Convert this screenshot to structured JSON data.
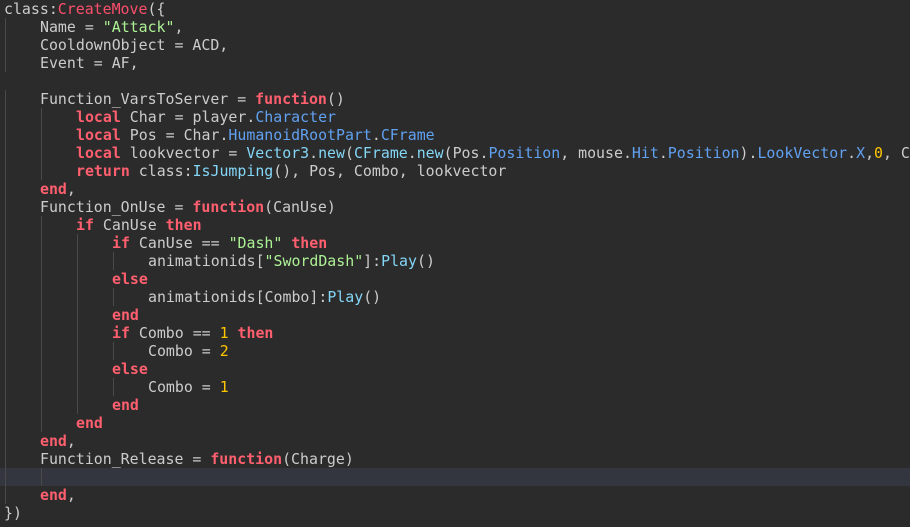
{
  "theme": {
    "background": "#2b2b2b",
    "current_line": "#34363f",
    "text": "#cccccc",
    "keyword": "#ff5f6e",
    "function_name": "#fd4e6b",
    "string": "#adf195",
    "number": "#ffc600",
    "property": "#61a1f1",
    "builtin": "#84d6f7"
  },
  "current_line_index": 26,
  "lines": [
    {
      "indent": 0,
      "tokens": [
        [
          "t",
          "class:"
        ],
        [
          "fn",
          "CreateMove"
        ],
        [
          "t",
          "({"
        ]
      ]
    },
    {
      "indent": 1,
      "tokens": [
        [
          "t",
          "Name = "
        ],
        [
          "str",
          "\"Attack\""
        ],
        [
          "t",
          ","
        ]
      ]
    },
    {
      "indent": 1,
      "tokens": [
        [
          "t",
          "CooldownObject = ACD,"
        ]
      ]
    },
    {
      "indent": 1,
      "tokens": [
        [
          "t",
          "Event = AF,"
        ]
      ]
    },
    {
      "indent": 0,
      "tokens": []
    },
    {
      "indent": 1,
      "tokens": [
        [
          "t",
          "Function_VarsToServer = "
        ],
        [
          "kw",
          "function"
        ],
        [
          "t",
          "()"
        ]
      ]
    },
    {
      "indent": 2,
      "tokens": [
        [
          "kw",
          "local"
        ],
        [
          "t",
          " Char = player."
        ],
        [
          "prop",
          "Character"
        ]
      ]
    },
    {
      "indent": 2,
      "tokens": [
        [
          "kw",
          "local"
        ],
        [
          "t",
          " Pos = Char."
        ],
        [
          "prop",
          "HumanoidRootPart"
        ],
        [
          "t",
          "."
        ],
        [
          "prop",
          "CFrame"
        ]
      ]
    },
    {
      "indent": 2,
      "tokens": [
        [
          "kw",
          "local"
        ],
        [
          "t",
          " lookvector = "
        ],
        [
          "builtin",
          "Vector3"
        ],
        [
          "t",
          "."
        ],
        [
          "builtin",
          "new"
        ],
        [
          "t",
          "("
        ],
        [
          "builtin",
          "CFrame"
        ],
        [
          "t",
          "."
        ],
        [
          "builtin",
          "new"
        ],
        [
          "t",
          "(Pos."
        ],
        [
          "prop",
          "Position"
        ],
        [
          "t",
          ", mouse."
        ],
        [
          "prop",
          "Hit"
        ],
        [
          "t",
          "."
        ],
        [
          "prop",
          "Position"
        ],
        [
          "t",
          ")."
        ],
        [
          "prop",
          "LookVector"
        ],
        [
          "t",
          "."
        ],
        [
          "prop",
          "X"
        ],
        [
          "t",
          ","
        ],
        [
          "num",
          "0"
        ],
        [
          "t",
          ", C"
        ]
      ]
    },
    {
      "indent": 2,
      "tokens": [
        [
          "kw",
          "return"
        ],
        [
          "t",
          " class:"
        ],
        [
          "builtin",
          "IsJumping"
        ],
        [
          "t",
          "(), Pos, Combo, lookvector"
        ]
      ]
    },
    {
      "indent": 1,
      "tokens": [
        [
          "kw",
          "end"
        ],
        [
          "t",
          ","
        ]
      ]
    },
    {
      "indent": 1,
      "tokens": [
        [
          "t",
          "Function_OnUse = "
        ],
        [
          "kw",
          "function"
        ],
        [
          "t",
          "(CanUse)"
        ]
      ]
    },
    {
      "indent": 2,
      "tokens": [
        [
          "kw",
          "if"
        ],
        [
          "t",
          " CanUse "
        ],
        [
          "kw",
          "then"
        ]
      ]
    },
    {
      "indent": 3,
      "tokens": [
        [
          "kw",
          "if"
        ],
        [
          "t",
          " CanUse == "
        ],
        [
          "str",
          "\"Dash\""
        ],
        [
          "t",
          " "
        ],
        [
          "kw",
          "then"
        ]
      ]
    },
    {
      "indent": 4,
      "tokens": [
        [
          "t",
          "animationids["
        ],
        [
          "str",
          "\"SwordDash\""
        ],
        [
          "t",
          "]:"
        ],
        [
          "builtin",
          "Play"
        ],
        [
          "t",
          "()"
        ]
      ]
    },
    {
      "indent": 3,
      "tokens": [
        [
          "kw",
          "else"
        ]
      ]
    },
    {
      "indent": 4,
      "tokens": [
        [
          "t",
          "animationids[Combo]:"
        ],
        [
          "builtin",
          "Play"
        ],
        [
          "t",
          "()"
        ]
      ]
    },
    {
      "indent": 3,
      "tokens": [
        [
          "kw",
          "end"
        ]
      ]
    },
    {
      "indent": 3,
      "tokens": [
        [
          "kw",
          "if"
        ],
        [
          "t",
          " Combo == "
        ],
        [
          "num",
          "1"
        ],
        [
          "t",
          " "
        ],
        [
          "kw",
          "then"
        ]
      ]
    },
    {
      "indent": 4,
      "tokens": [
        [
          "t",
          "Combo = "
        ],
        [
          "num",
          "2"
        ]
      ]
    },
    {
      "indent": 3,
      "tokens": [
        [
          "kw",
          "else"
        ]
      ]
    },
    {
      "indent": 4,
      "tokens": [
        [
          "t",
          "Combo = "
        ],
        [
          "num",
          "1"
        ]
      ]
    },
    {
      "indent": 3,
      "tokens": [
        [
          "kw",
          "end"
        ]
      ]
    },
    {
      "indent": 2,
      "tokens": [
        [
          "kw",
          "end"
        ]
      ]
    },
    {
      "indent": 1,
      "tokens": [
        [
          "kw",
          "end"
        ],
        [
          "t",
          ","
        ]
      ]
    },
    {
      "indent": 1,
      "tokens": [
        [
          "t",
          "Function_Release = "
        ],
        [
          "kw",
          "function"
        ],
        [
          "t",
          "(Charge)"
        ]
      ]
    },
    {
      "indent": 2,
      "tokens": []
    },
    {
      "indent": 1,
      "tokens": [
        [
          "kw",
          "end"
        ],
        [
          "t",
          ","
        ]
      ]
    },
    {
      "indent": 0,
      "tokens": [
        [
          "t",
          "})"
        ]
      ]
    }
  ]
}
